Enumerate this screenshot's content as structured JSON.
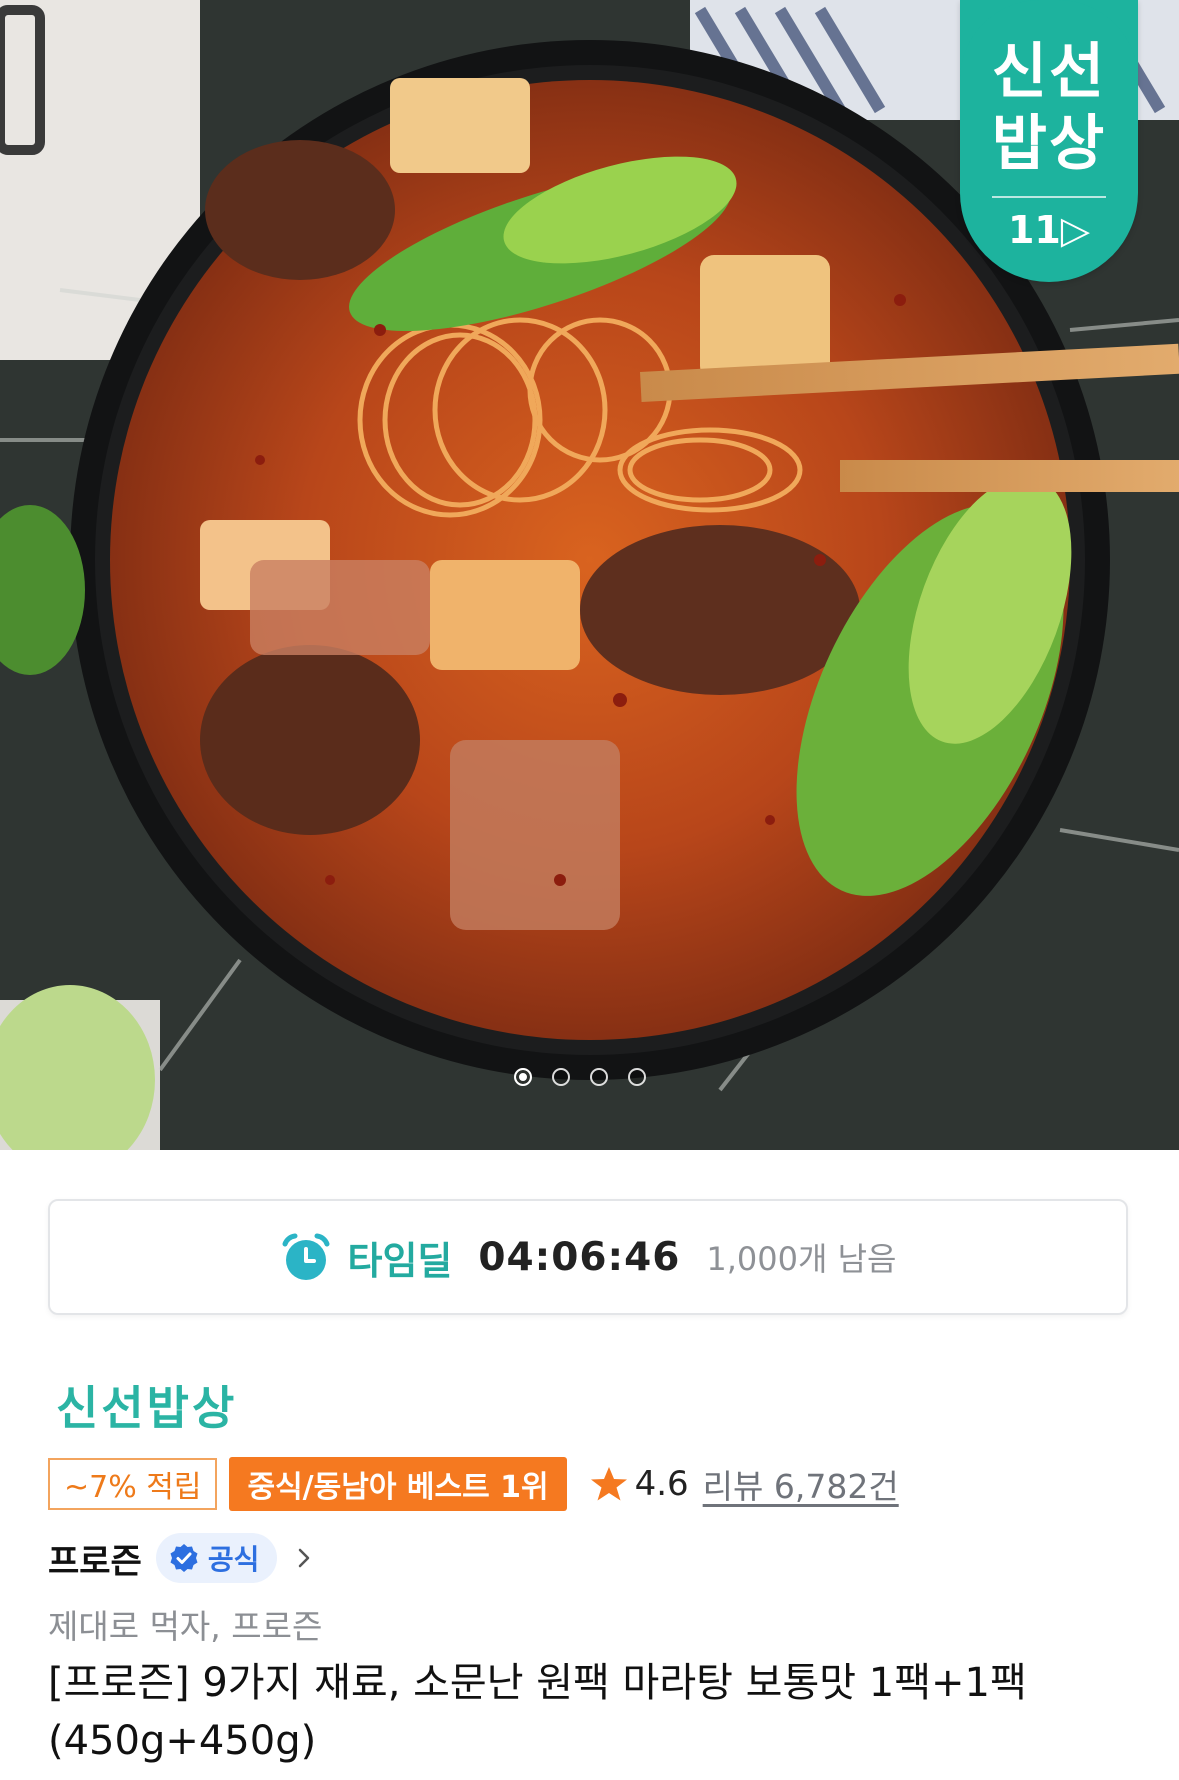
{
  "hero": {
    "badge": {
      "text": "신선\n밥상",
      "logo": "11▷"
    },
    "carousel": {
      "total": 4,
      "active": 1
    }
  },
  "time_deal": {
    "icon": "alarm-clock-icon",
    "label": "타임딜",
    "timer": "04:06:46",
    "remaining": "1,000개 남음",
    "accent_color": "#23aaa0"
  },
  "product": {
    "brand_title": "신선밥상",
    "points_tag": "~7% 적립",
    "best_tag": "중식/동남아 베스트 1위",
    "rating": "4.6",
    "review_link": "리뷰 6,782건",
    "seller": "프로즌",
    "official_label": "공식",
    "tagline": "제대로 먹자, 프로즌",
    "title": "[프로즌] 9가지 재료, 소문난 원팩 마라탕 보통맛 1팩+1팩 (450g+450g)"
  },
  "colors": {
    "brand_teal": "#2bb4a4",
    "best_orange": "#f57920",
    "points_orange": "#ee7a1a",
    "official_blue": "#2d6fe0",
    "star_orange": "#f57920"
  }
}
